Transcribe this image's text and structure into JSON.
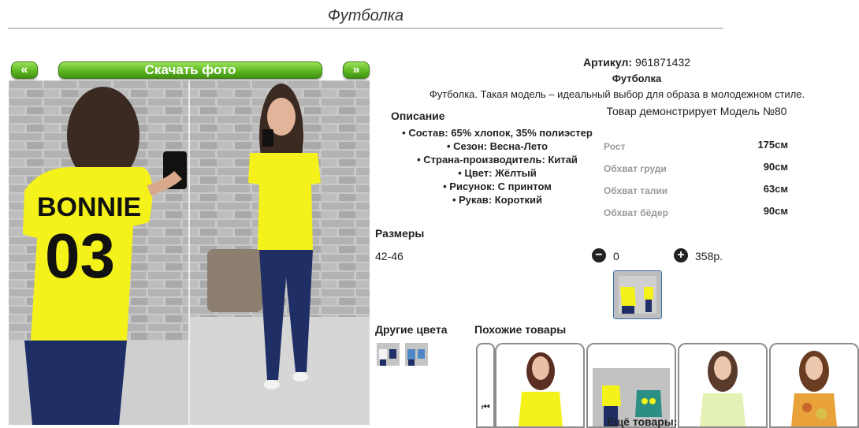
{
  "page": {
    "title": "Футболка"
  },
  "gallery": {
    "prev_label": "«",
    "next_label": "»",
    "download_label": "Скачать фото",
    "print_text_top": "BONNIE",
    "print_text_bottom": "03"
  },
  "product": {
    "article_label": "Артикул:",
    "article_value": "961871432",
    "name": "Футболка",
    "description": "Футболка. Такая модель – идеальный выбор для образа в молодежном стиле.",
    "model_note": "Товар демонстрирует Модель №80"
  },
  "description_section": {
    "heading": "Описание",
    "items": [
      "Состав: 65% хлопок, 35% полиэстер",
      "Сезон: Весна-Лето",
      "Страна-производитель: Китай",
      "Цвет: Жёлтый",
      "Рисунок: С принтом",
      "Рукав: Короткий"
    ]
  },
  "measurements": [
    {
      "label": "Рост",
      "value": "175см"
    },
    {
      "label": "Обхват груди",
      "value": "90см"
    },
    {
      "label": "Обхват талии",
      "value": "63см"
    },
    {
      "label": "Обхват бёдер",
      "value": "90см"
    }
  ],
  "sizes": {
    "heading": "Размеры",
    "rows": [
      {
        "name": "42-46",
        "qty": "0",
        "price": "358р."
      }
    ]
  },
  "other_colors": {
    "heading": "Другие цвета",
    "count": 2
  },
  "similar": {
    "heading": "Похожие товары",
    "more_label": "Ещё товары:"
  },
  "colors": {
    "accent_green": "#5fb821",
    "shirt_yellow": "#f4f21a",
    "jeans_navy": "#1f2f66",
    "brick_gray": "#b9b9b9"
  },
  "icons": {
    "prev": "double-chevron-left-icon",
    "next": "double-chevron-right-icon",
    "minus": "minus-circle-icon",
    "plus": "plus-circle-icon",
    "carousel_first": "skip-first-icon"
  }
}
